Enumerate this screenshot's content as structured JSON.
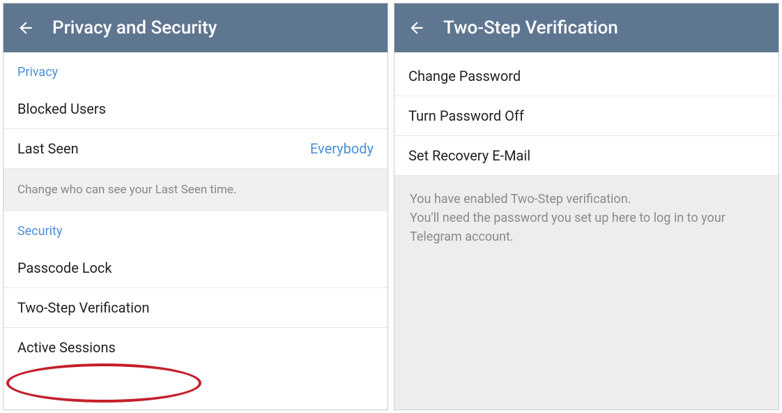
{
  "left": {
    "header": {
      "title": "Privacy and Security"
    },
    "privacy_section": {
      "label": "Privacy",
      "blocked_users": "Blocked Users",
      "last_seen": {
        "label": "Last Seen",
        "value": "Everybody"
      },
      "description": "Change who can see your Last Seen time."
    },
    "security_section": {
      "label": "Security",
      "passcode_lock": "Passcode Lock",
      "two_step": "Two-Step Verification",
      "active_sessions": "Active Sessions"
    }
  },
  "right": {
    "header": {
      "title": "Two-Step Verification"
    },
    "items": {
      "change_password": "Change Password",
      "turn_off": "Turn Password Off",
      "recovery_email": "Set Recovery E-Mail"
    },
    "description": "You have enabled Two-Step verification.\nYou'll need the password you set up here to log in to your Telegram account."
  }
}
